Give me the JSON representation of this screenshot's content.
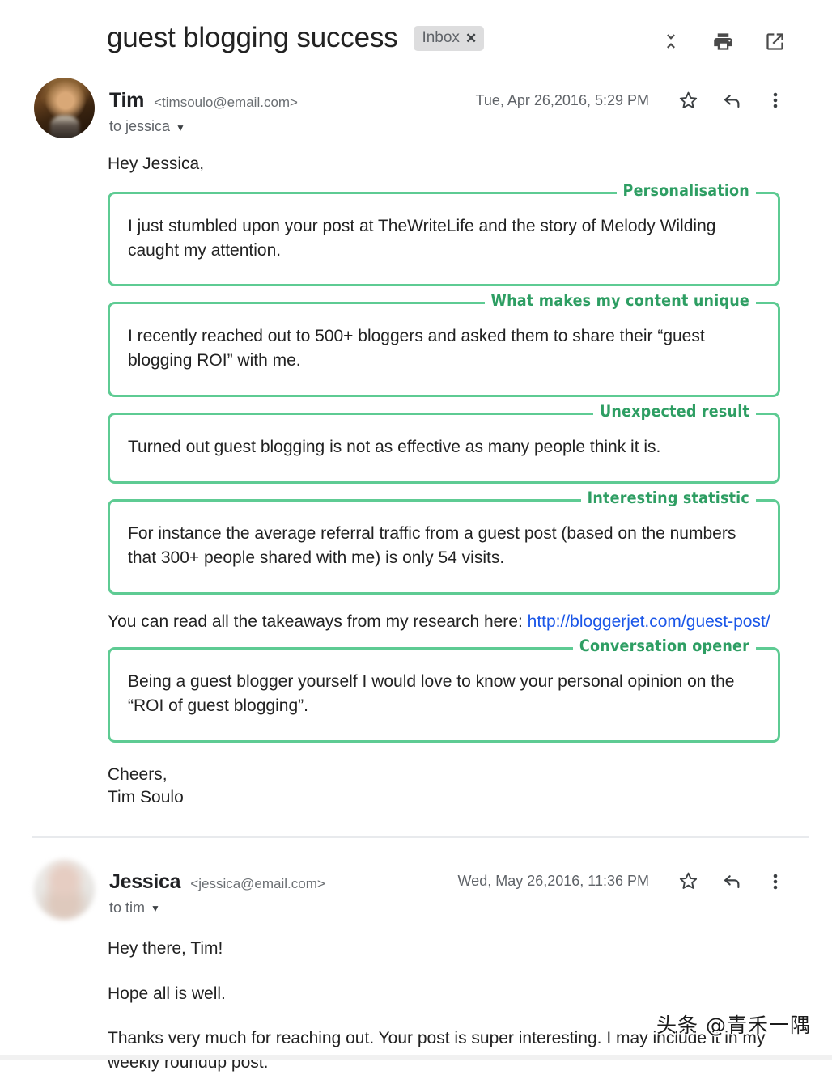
{
  "header": {
    "subject": "guest blogging success",
    "label_chip": "Inbox",
    "chip_close": "✕",
    "actions": [
      {
        "name": "collapse-all-icon",
        "tooltip": "Collapse all"
      },
      {
        "name": "print-icon",
        "tooltip": "Print all"
      },
      {
        "name": "open-in-new-window-icon",
        "tooltip": "In new window"
      }
    ]
  },
  "messages": [
    {
      "sender_name": "Tim",
      "sender_email": "<timsoulo@email.com>",
      "recipient": "to jessica",
      "date": "Tue, Apr 26,2016, 5:29 PM",
      "greeting": "Hey Jessica,",
      "blocks": [
        {
          "type": "annotated",
          "label": "Personalisation",
          "text": "I just stumbled upon your post at TheWriteLife and the story of Melody Wilding caught my attention."
        },
        {
          "type": "annotated",
          "label": "What makes my content unique",
          "text": "I recently reached out to 500+ bloggers and asked them to share their “guest blogging ROI” with me."
        },
        {
          "type": "annotated",
          "label": "Unexpected result",
          "text": "Turned out guest blogging is not as effective as many people think it is."
        },
        {
          "type": "annotated",
          "label": "Interesting statistic",
          "text": "For instance the average referral traffic from a guest post (based on the numbers that 300+ people shared with me) is only 54 visits."
        },
        {
          "type": "plain",
          "text_before_link": "You can read all the takeaways from my research here: ",
          "link_text": "http://bloggerjet.com/guest-post/"
        },
        {
          "type": "annotated",
          "label": "Conversation opener",
          "text": "Being a guest blogger yourself I would love to know your personal opinion on the “ROI of guest blogging”."
        }
      ],
      "signature_line1": "Cheers,",
      "signature_line2": "Tim Soulo"
    },
    {
      "sender_name": "Jessica",
      "sender_email": "<jessica@email.com>",
      "recipient": "to tim",
      "date": "Wed, May 26,2016, 11:36 PM",
      "paragraphs": [
        "Hey there, Tim!",
        "Hope all is well.",
        "Thanks very much for reaching out. Your post is super interesting. I may include it in my weekly roundup post."
      ]
    }
  ],
  "watermark": "头条 @青禾一隅",
  "colors": {
    "annotation_border": "#5ecb93",
    "annotation_label": "#2e9e63",
    "link": "#1a56e8",
    "chip_background": "#ddddde"
  }
}
